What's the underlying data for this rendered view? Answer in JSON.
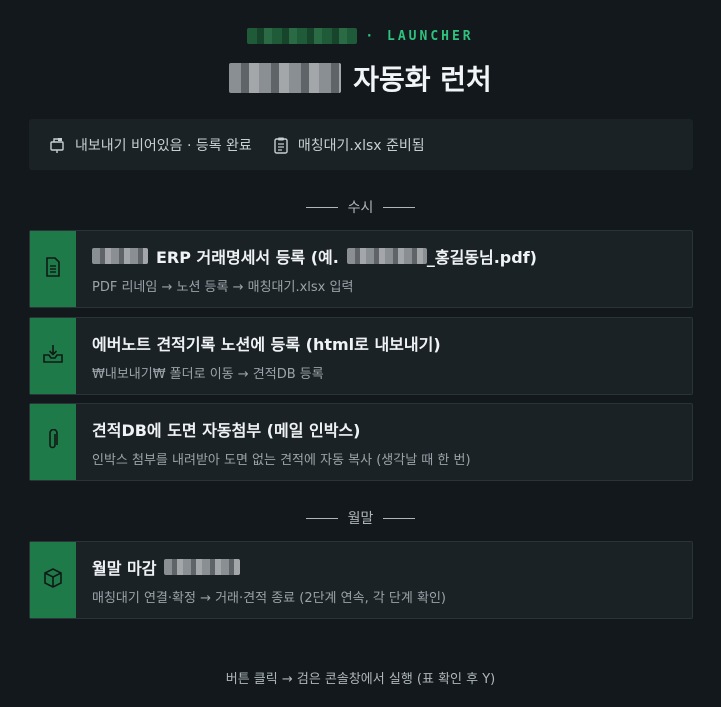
{
  "header": {
    "eyebrow_label": "· LAUNCHER",
    "title_text": "자동화 런처"
  },
  "status": {
    "export_text": "내보내기 비어있음 · 등록 완료",
    "matching_text": "매칭대기.xlsx 준비됨"
  },
  "sections": [
    {
      "label": "수시"
    },
    {
      "label": "월말"
    }
  ],
  "cards": [
    {
      "icon": "document-icon",
      "title_suffix": "ERP 거래명세서 등록 (예.",
      "title_tail": "_홍길동님.pdf)",
      "subtitle": "PDF 리네임 → 노션 등록 → 매칭대기.xlsx 입력"
    },
    {
      "icon": "download-tray-icon",
      "title": "에버노트 견적기록 노션에 등록 (html로 내보내기)",
      "subtitle": "₩내보내기₩ 폴더로 이동 → 견적DB 등록"
    },
    {
      "icon": "paperclip-icon",
      "title": "견적DB에 도면 자동첨부 (메일 인박스)",
      "subtitle": "인박스 첨부를 내려받아 도면 없는 견적에 자동 복사 (생각날 때 한 번)"
    },
    {
      "icon": "package-icon",
      "title": "월말 마감",
      "subtitle": "매칭대기 연결·확정 → 거래·견적 종료 (2단계 연속, 각 단계 확인)"
    }
  ],
  "footer": {
    "text": "버튼 클릭 → 검은 콘솔창에서 실행 (표 확인 후 Y)"
  },
  "colors": {
    "background": "#12181b",
    "card": "#1b2226",
    "accent": "#1f7a4a",
    "brand_green": "#2ec27e"
  }
}
